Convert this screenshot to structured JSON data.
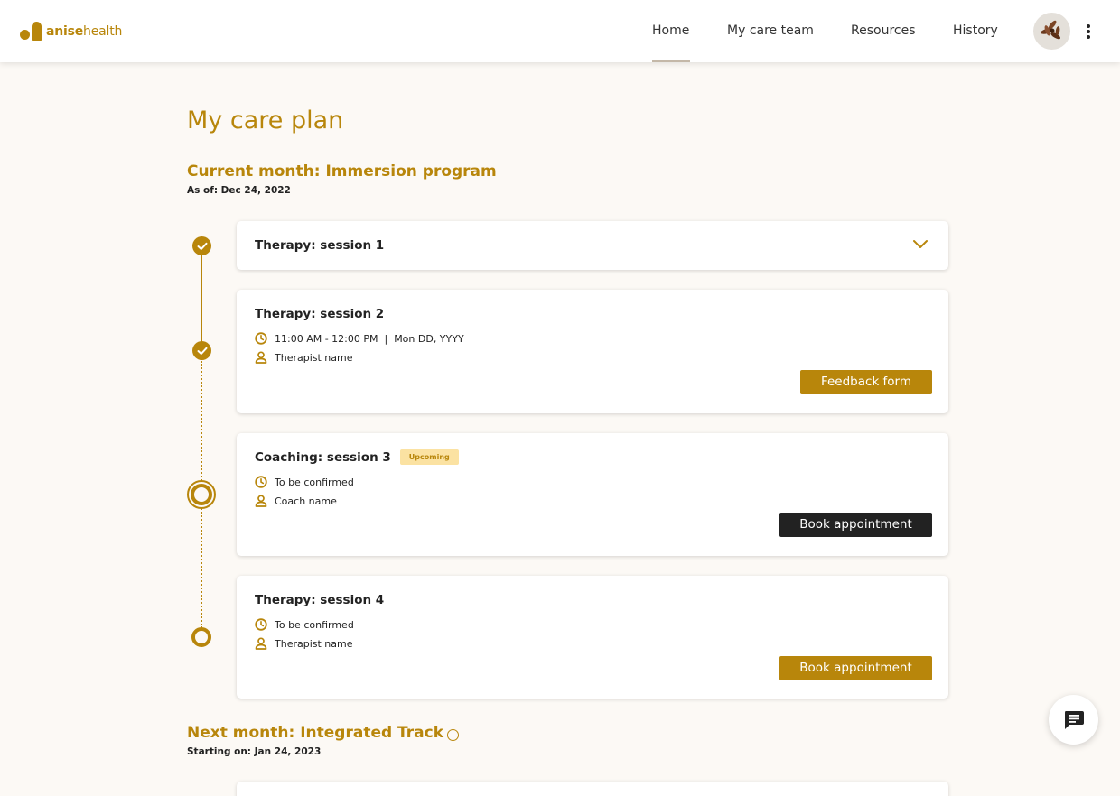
{
  "brand": {
    "name_bold": "anise",
    "name_light": "health",
    "color": "#b8860b"
  },
  "nav": {
    "items": [
      {
        "label": "Home",
        "active": true
      },
      {
        "label": "My care team",
        "active": false
      },
      {
        "label": "Resources",
        "active": false
      },
      {
        "label": "History",
        "active": false
      }
    ]
  },
  "page": {
    "title": "My care plan"
  },
  "current_section": {
    "title": "Current month: Immersion program",
    "subtitle": "As of: Dec 24, 2022"
  },
  "sessions": [
    {
      "title": "Therapy: session 1",
      "status": "completed",
      "collapsed": true
    },
    {
      "title": "Therapy: session 2",
      "status": "completed",
      "time": "11:00 AM - 12:00 PM  |  Mon DD, YYYY",
      "provider": "Therapist name",
      "button": "Feedback form"
    },
    {
      "title": "Coaching: session 3",
      "status": "upcoming",
      "badge": "Upcoming",
      "time": "To be confirmed",
      "provider": "Coach name",
      "button": "Book appointment"
    },
    {
      "title": "Therapy: session 4",
      "status": "pending",
      "time": "To be confirmed",
      "provider": "Therapist name",
      "button": "Book appointment"
    }
  ],
  "next_section": {
    "title": "Next month: Integrated Track",
    "info_icon": "info-icon",
    "subtitle": "Starting on: Jan 24, 2023"
  },
  "icons": {
    "clock": "clock-icon",
    "person": "person-icon",
    "chat": "chat-icon",
    "chevron": "chevron-down-icon",
    "more": "more-vertical-icon"
  },
  "colors": {
    "accent": "#b8860b",
    "dark": "#222222",
    "badge_bg": "#fbe2a2",
    "page_bg": "#fcf9f5"
  }
}
